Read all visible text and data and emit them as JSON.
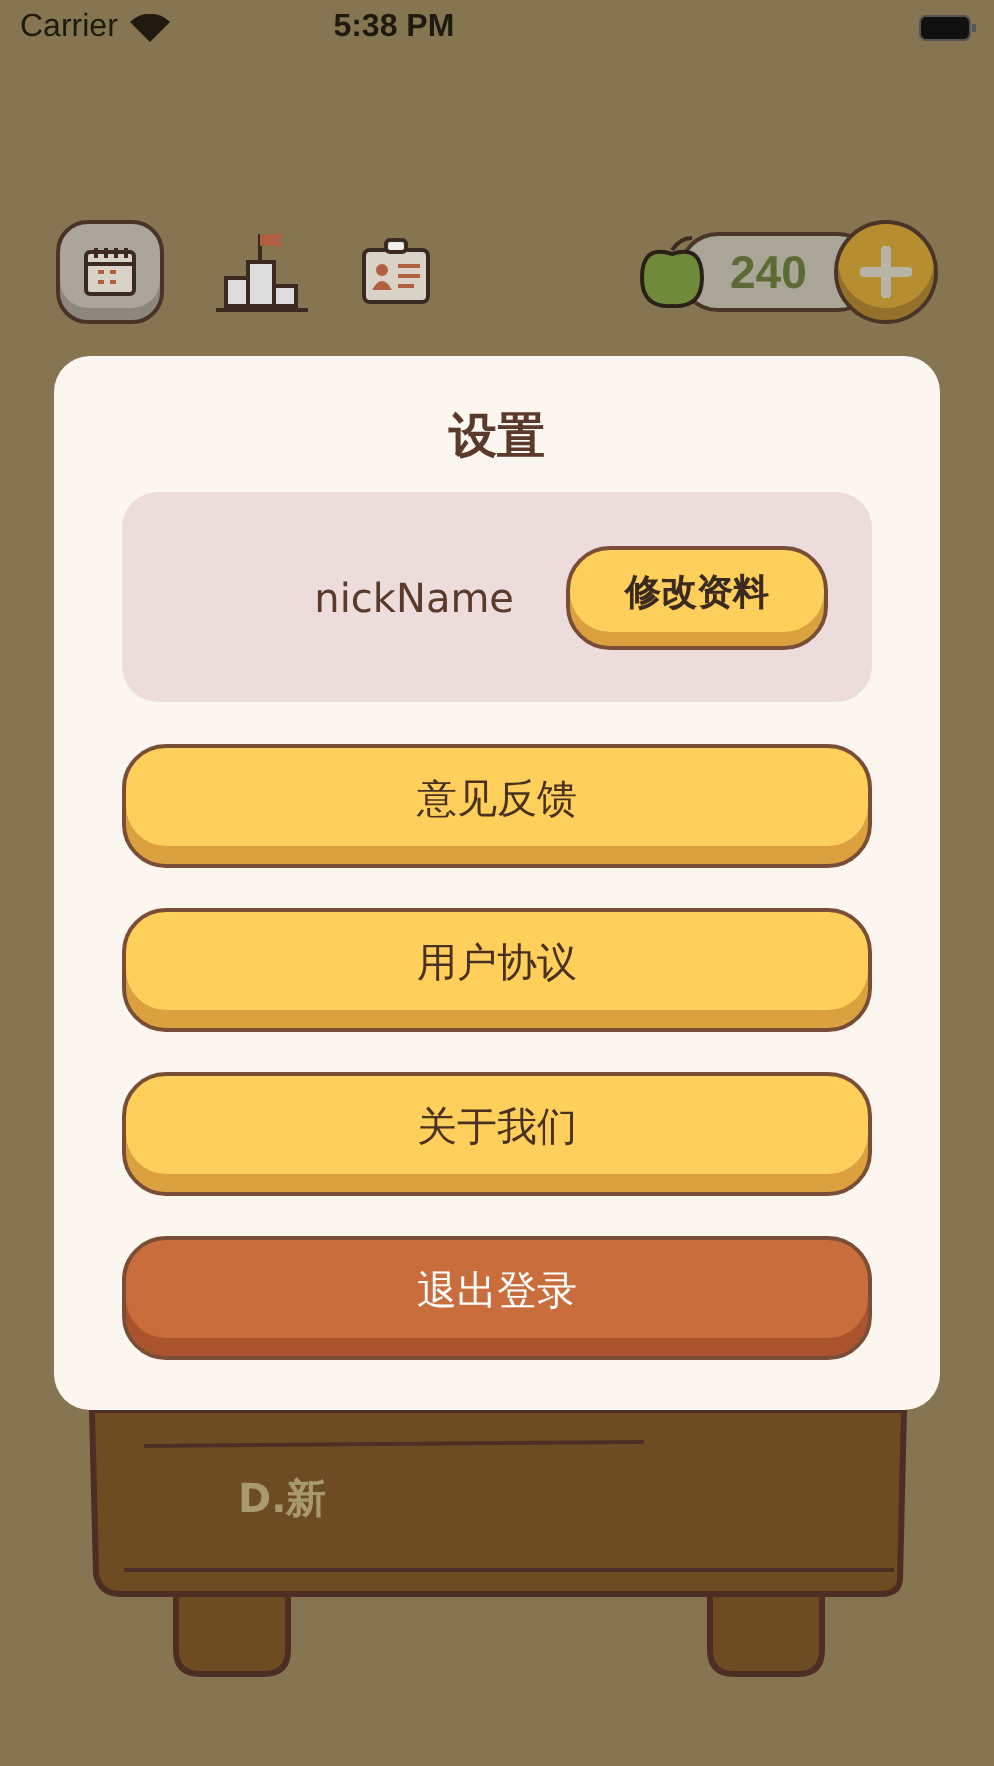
{
  "status_bar": {
    "carrier": "Carrier",
    "time": "5:38 PM"
  },
  "toolbar": {
    "apple_count": "240"
  },
  "desk": {
    "option": "D.新"
  },
  "dialog": {
    "title": "设置",
    "nickname": "nickName",
    "edit_button": "修改资料",
    "menu": [
      {
        "label": "意见反馈",
        "kind": "primary"
      },
      {
        "label": "用户协议",
        "kind": "primary"
      },
      {
        "label": "关于我们",
        "kind": "primary"
      },
      {
        "label": "退出登录",
        "kind": "danger"
      }
    ]
  }
}
